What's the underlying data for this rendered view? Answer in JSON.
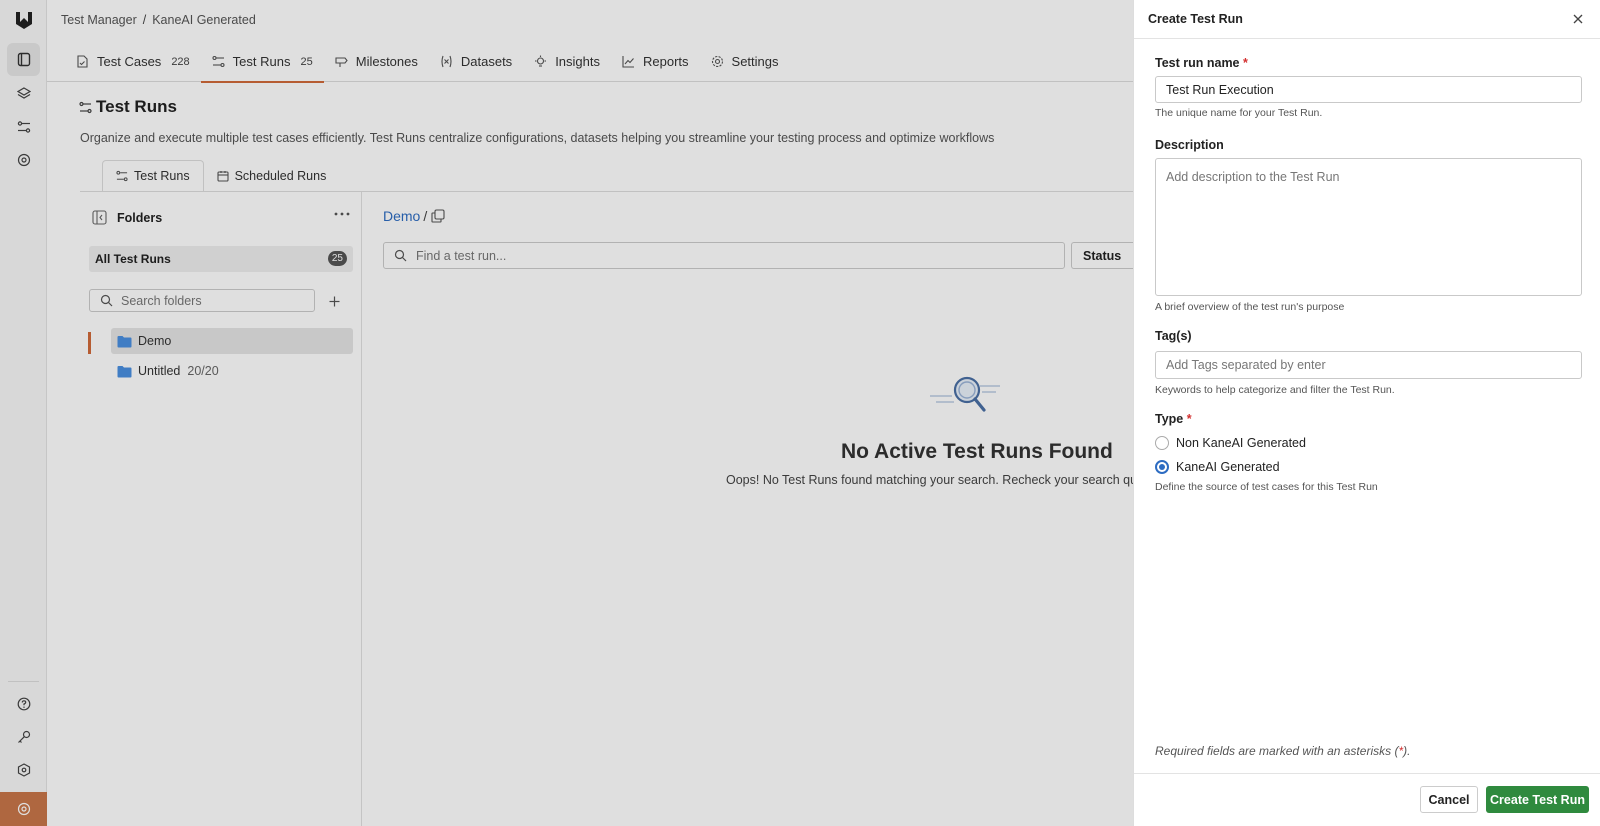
{
  "breadcrumb": {
    "root": "Test Manager",
    "separator": "/",
    "current": "KaneAI Generated"
  },
  "nav_tabs": [
    {
      "label": "Test Cases",
      "count": "228",
      "icon": "test-case-icon"
    },
    {
      "label": "Test Runs",
      "count": "25",
      "icon": "test-run-icon",
      "active": true
    },
    {
      "label": "Milestones",
      "icon": "milestone-icon"
    },
    {
      "label": "Datasets",
      "icon": "dataset-icon"
    },
    {
      "label": "Insights",
      "icon": "insights-icon"
    },
    {
      "label": "Reports",
      "icon": "reports-icon"
    },
    {
      "label": "Settings",
      "icon": "gear-icon"
    }
  ],
  "page": {
    "title": "Test Runs",
    "description": "Organize and execute multiple test cases efficiently. Test Runs centralize configurations, datasets helping you streamline your testing process and optimize workflows"
  },
  "sub_tabs": [
    {
      "label": "Test Runs",
      "active": true
    },
    {
      "label": "Scheduled Runs"
    }
  ],
  "folders": {
    "title": "Folders",
    "all_label": "All Test Runs",
    "all_count": "25",
    "search_placeholder": "Search folders",
    "items": [
      {
        "name": "Demo",
        "meta": "",
        "active": true
      },
      {
        "name": "Untitled",
        "meta": "20/20"
      }
    ]
  },
  "content": {
    "crumb": "Demo",
    "crumb_sep": "/",
    "search_placeholder": "Find a test run...",
    "status_label": "Status",
    "empty_title": "No Active Test Runs Found",
    "empty_desc": "Oops! No Test Runs found matching your search. Recheck your search query a"
  },
  "drawer": {
    "title": "Create Test Run",
    "name_label": "Test run name",
    "name_value": "Test Run Execution",
    "name_hint": "The unique name for your Test Run.",
    "desc_label": "Description",
    "desc_placeholder": "Add description to the Test Run",
    "desc_hint": "A brief overview of the test run's purpose",
    "tags_label": "Tag(s)",
    "tags_placeholder": "Add Tags separated by enter",
    "tags_hint": "Keywords to help categorize and filter the Test Run.",
    "type_label": "Type",
    "type_options": [
      {
        "label": "Non KaneAI Generated",
        "selected": false
      },
      {
        "label": "KaneAI Generated",
        "selected": true
      }
    ],
    "type_hint": "Define the source of test cases for this Test Run",
    "required_note_pre": "Required fields are marked with an asterisks (",
    "required_note_star": "*",
    "required_note_post": ").",
    "required_star": "*",
    "cancel_label": "Cancel",
    "create_label": "Create Test Run"
  },
  "colors": {
    "accent": "#d06a3a",
    "primary_button": "#2f8a3e",
    "link": "#2d6cc2",
    "required": "#d32f2f"
  }
}
